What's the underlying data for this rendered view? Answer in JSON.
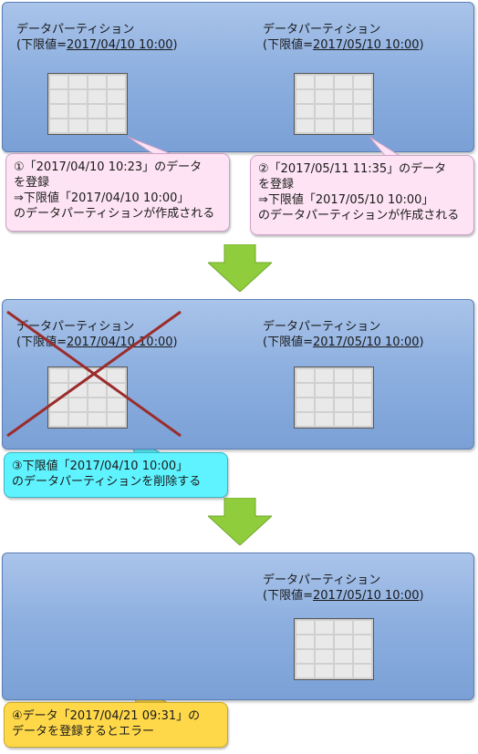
{
  "partition_label": "データパーティション",
  "stage1": {
    "left": {
      "prefix": "(下限値=",
      "date": "2017/04/10 10:00",
      "suffix": ")"
    },
    "right": {
      "prefix": "(下限値=",
      "date": "2017/05/10 10:00",
      "suffix": ")"
    },
    "callout_left": [
      "①「2017/04/10 10:23」のデータ",
      "を登録",
      "⇒下限値「2017/04/10 10:00」",
      "のデータパーティションが作成される"
    ],
    "callout_right": [
      "②「2017/05/11 11:35」のデータ",
      "を登録",
      "⇒下限値「2017/05/10 10:00」",
      "のデータパーティションが作成される"
    ]
  },
  "stage2": {
    "left": {
      "prefix": "(下限値=",
      "date": "2017/04/10 10:00",
      "suffix": ")"
    },
    "right": {
      "prefix": "(下限値=",
      "date": "2017/05/10 10:00",
      "suffix": ")"
    },
    "callout": [
      "③下限値「2017/04/10 10:00」",
      "のデータパーティションを削除する"
    ]
  },
  "stage3": {
    "right": {
      "prefix": "(下限値=",
      "date": "2017/05/10 10:00",
      "suffix": ")"
    },
    "callout": [
      "④データ「2017/04/21 09:31」の",
      "データを登録するとエラー"
    ]
  },
  "colors": {
    "panel": "#8eb0e0",
    "callout_pink": "#fde3f3",
    "callout_cyan": "#5ef3ff",
    "callout_yellow": "#ffd84a",
    "arrow": "#8fcd3c",
    "cross": "#9b2c2c"
  }
}
